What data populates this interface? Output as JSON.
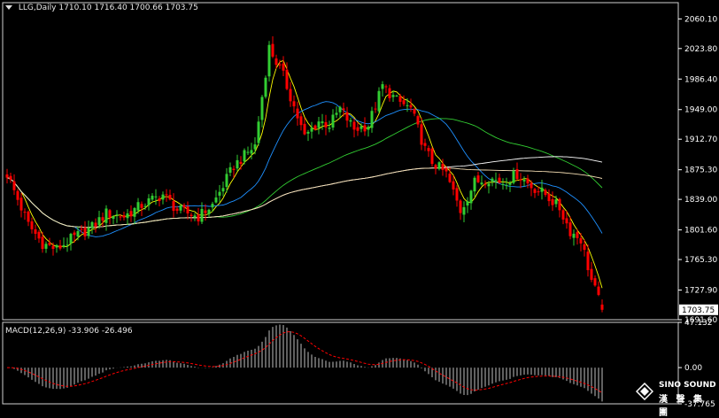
{
  "header": {
    "symbol": "LLG,Daily",
    "ohlc": "1710.10 1716.40 1700.66 1703.75"
  },
  "macd_header": {
    "label": "MACD(12,26,9)",
    "values": "-33.906 -26.496"
  },
  "watermark": {
    "brand": "SINO SOUND",
    "sub": "漢 聲 集 團"
  },
  "colors": {
    "background": "#000000",
    "bull": "#32CD32",
    "bear": "#FF0000",
    "ma5": "#FFFF00",
    "ma20": "#1E90FF",
    "ma60": "#32CD32",
    "ma120": "#FFFFFF",
    "ma240": "#F5DEB3",
    "macd_hist": "#C0C0C0",
    "macd_signal": "#FF0000",
    "axis": "#FFFFFF",
    "price_tag_bg": "#FFFFFF",
    "price_tag_fg": "#000000"
  },
  "chart_data": [
    {
      "type": "candlestick",
      "title": "LLG,Daily",
      "ylim": [
        1691.6,
        2080.0
      ],
      "y_ticks": [
        "2060.10",
        "2023.80",
        "1986.40",
        "1949.00",
        "1912.70",
        "1875.30",
        "1839.00",
        "1801.60",
        "1765.30",
        "1727.90",
        "1691.60"
      ],
      "last_price": "1703.75",
      "anchors": {
        "x_bar": [
          0,
          6,
          10,
          14,
          18,
          24,
          28,
          33,
          38,
          44,
          48,
          54,
          58,
          64,
          70,
          74,
          78,
          84,
          88,
          91,
          94,
          98,
          102,
          106,
          110,
          114,
          118,
          120,
          124,
          128,
          132,
          136,
          140,
          144,
          148,
          152,
          156,
          159,
          162,
          165,
          168
        ],
        "close": [
          1870,
          1808,
          1785,
          1778,
          1790,
          1805,
          1822,
          1818,
          1832,
          1845,
          1826,
          1818,
          1832,
          1880,
          1905,
          2025,
          1990,
          1915,
          1935,
          1930,
          1950,
          1925,
          1930,
          1978,
          1960,
          1950,
          1900,
          1885,
          1870,
          1825,
          1860,
          1865,
          1860,
          1870,
          1855,
          1845,
          1828,
          1800,
          1790,
          1740,
          1704
        ]
      },
      "last_bar": {
        "open": 1710.1,
        "high": 1716.4,
        "low": 1700.66,
        "close": 1703.75
      },
      "moving_averages": [
        {
          "period": 5,
          "color": "#FFFF00"
        },
        {
          "period": 20,
          "color": "#1E90FF"
        },
        {
          "period": 60,
          "color": "#32CD32"
        },
        {
          "period": 120,
          "color": "#FFFFFF"
        },
        {
          "period": 240,
          "color": "#F5DEB3"
        }
      ]
    },
    {
      "type": "macd",
      "title": "MACD(12,26,9)",
      "params": [
        12,
        26,
        9
      ],
      "ylim": [
        -37.765,
        47.132
      ],
      "y_ticks": [
        "47.132",
        "0.00",
        "-37.765"
      ],
      "last_macd": -33.906,
      "last_signal": -26.496
    }
  ]
}
